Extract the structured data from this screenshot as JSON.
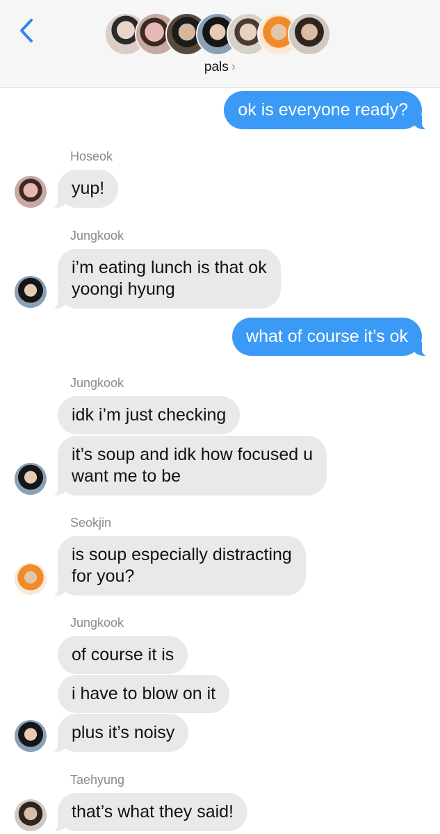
{
  "header": {
    "group_name": "pals",
    "chevron": "›",
    "back_icon": "chevron-left-icon",
    "member_avatars": [
      "member-avatar-1",
      "member-avatar-2",
      "member-avatar-3",
      "member-avatar-4",
      "member-avatar-5",
      "member-avatar-6",
      "member-avatar-7"
    ]
  },
  "colors": {
    "outgoing_bubble": "#3b9af6",
    "incoming_bubble": "#e9e9ec",
    "back_chevron": "#2f86f6",
    "sender_name": "#8a8a8e"
  },
  "messages": [
    {
      "type": "outgoing",
      "text": "ok is everyone ready?"
    },
    {
      "type": "sender",
      "text": "Hoseok"
    },
    {
      "type": "incoming",
      "sender": "Hoseok",
      "text": "yup!"
    },
    {
      "type": "sender",
      "text": "Jungkook"
    },
    {
      "type": "incoming",
      "sender": "Jungkook",
      "lines": [
        "i’m eating lunch is that ok",
        "yoongi hyung"
      ]
    },
    {
      "type": "outgoing",
      "text": "what of course it’s ok"
    },
    {
      "type": "sender",
      "text": "Jungkook"
    },
    {
      "type": "incoming",
      "sender": "Jungkook",
      "text": "idk i’m just checking"
    },
    {
      "type": "incoming",
      "sender": "Jungkook",
      "lines": [
        "it’s soup and idk how focused u",
        "want me to be"
      ]
    },
    {
      "type": "sender",
      "text": "Seokjin"
    },
    {
      "type": "incoming",
      "sender": "Seokjin",
      "lines": [
        "is soup especially distracting",
        "for you?"
      ]
    },
    {
      "type": "sender",
      "text": "Jungkook"
    },
    {
      "type": "incoming",
      "sender": "Jungkook",
      "text": "of course it is"
    },
    {
      "type": "incoming",
      "sender": "Jungkook",
      "text": "i have to blow on it"
    },
    {
      "type": "incoming",
      "sender": "Jungkook",
      "text": "plus it’s noisy"
    },
    {
      "type": "sender",
      "text": "Taehyung"
    },
    {
      "type": "incoming",
      "sender": "Taehyung",
      "text": "that’s what they said!"
    }
  ]
}
